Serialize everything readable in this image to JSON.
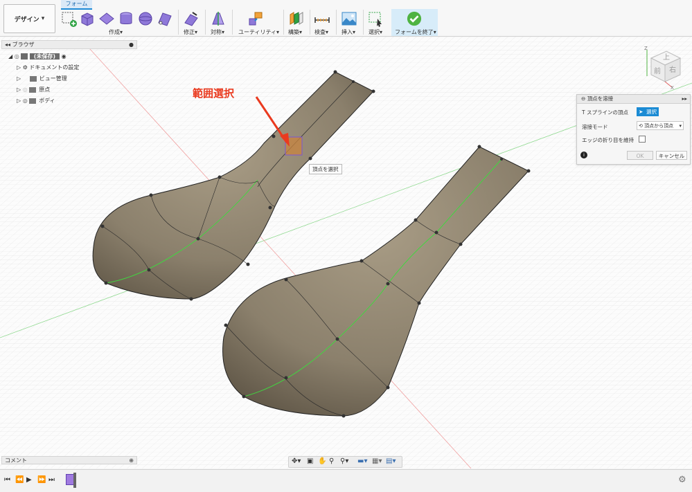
{
  "toolbar": {
    "workspace_label": "デザイン",
    "active_tab": "フォーム",
    "groups": [
      "作成",
      "修正",
      "対称",
      "ユーティリティ",
      "構築",
      "検査",
      "挿入",
      "選択",
      "フォームを終了"
    ]
  },
  "browser": {
    "title": "ブラウザ",
    "root": "(未保存)",
    "items": [
      "ドキュメントの設定",
      "ビュー管理",
      "原点",
      "ボディ"
    ]
  },
  "dialog": {
    "title": "頂点を溶接",
    "row1_label": "T スプラインの頂点",
    "select_button": "選択",
    "row2_label": "溶接モード",
    "weld_mode_value": "頂点から頂点",
    "row3_label": "エッジの折り目を維持",
    "ok_label": "OK",
    "cancel_label": "キャンセル"
  },
  "viewcube": {
    "top": "上",
    "front": "前",
    "right": "右",
    "axis_z": "Z",
    "axis_x": "X"
  },
  "viewport": {
    "annotation": "範囲選択",
    "tooltip": "頂点を選択",
    "accent_color": "#1b8bd4",
    "annotation_color": "#ea3a1f"
  },
  "comments": {
    "title": "コメント"
  }
}
